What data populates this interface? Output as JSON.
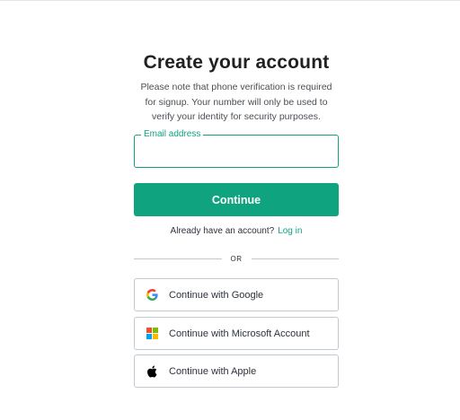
{
  "page": {
    "title": "Create your account",
    "note": "Please note that phone verification is required for signup. Your number will only be used to verify your identity for security purposes."
  },
  "email": {
    "label": "Email address",
    "value": ""
  },
  "continue_label": "Continue",
  "signin": {
    "prompt": "Already have an account?",
    "link": "Log in"
  },
  "divider": "OR",
  "social": {
    "google": "Continue with Google",
    "microsoft": "Continue with Microsoft Account",
    "apple": "Continue with Apple"
  },
  "colors": {
    "accent": "#10a37f",
    "border": "#c2c8d0",
    "google_blue": "#4285F4",
    "google_green": "#34A853",
    "google_yellow": "#FBBC05",
    "google_red": "#EA4335",
    "ms_red": "#F25022",
    "ms_green": "#7FBA00",
    "ms_blue": "#00A4EF",
    "ms_yellow": "#FFB900"
  },
  "icons": {
    "google": "google-icon",
    "microsoft": "microsoft-icon",
    "apple": "apple-icon"
  }
}
